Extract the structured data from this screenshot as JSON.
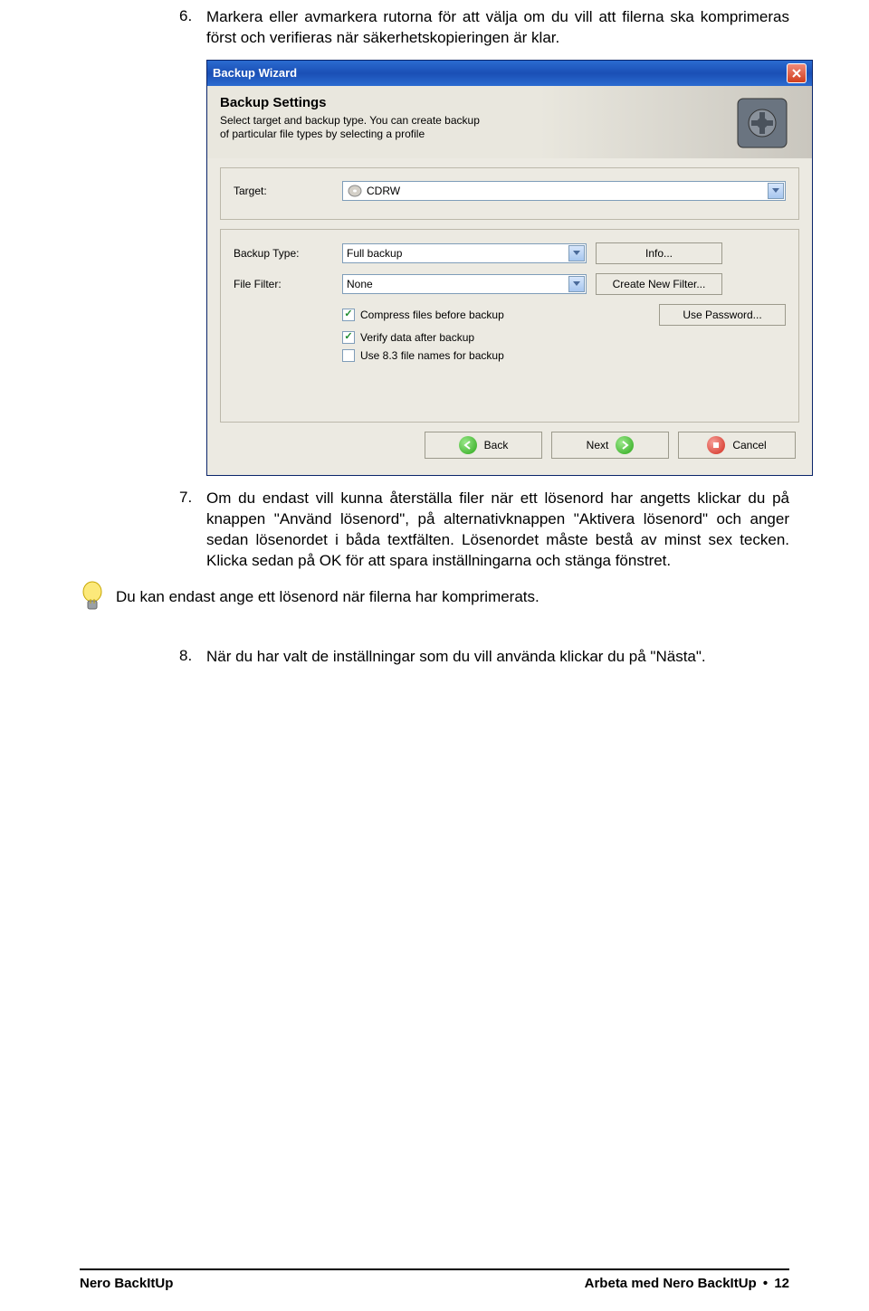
{
  "list": {
    "item6num": "6.",
    "item6text": "Markera eller avmarkera rutorna för att välja om du vill att filerna ska komprimeras först och verifieras när säkerhetskopieringen är klar.",
    "item7num": "7.",
    "item7text": "Om du endast vill kunna återställa filer när ett lösenord har angetts klickar du på knappen \"Använd lösenord\", på alternativknappen \"Aktivera lösenord\" och anger sedan lösenordet i båda textfälten. Lösenordet måste bestå av minst sex tecken. Klicka sedan på OK för att spara inställningarna och stänga fönstret.",
    "item8num": "8.",
    "item8text": "När du har valt de inställningar som du vill använda klickar du på \"Nästa\"."
  },
  "note": "Du kan endast ange ett lösenord när filerna har komprimerats.",
  "dialog": {
    "title": "Backup Wizard",
    "header": "Backup Settings",
    "header_sub": "Select target and backup type. You can create backup of particular file types by selecting a profile",
    "target_label": "Target:",
    "target_value": "CDRW",
    "backup_type_label": "Backup Type:",
    "backup_type_value": "Full backup",
    "info_btn": "Info...",
    "file_filter_label": "File Filter:",
    "file_filter_value": "None",
    "create_filter_btn": "Create New Filter...",
    "use_password_btn": "Use Password...",
    "chk_compress": "Compress files before backup",
    "chk_verify": "Verify data after backup",
    "chk_83": "Use 8.3 file names for backup",
    "back_btn": "Back",
    "next_btn": "Next",
    "cancel_btn": "Cancel"
  },
  "footer": {
    "left": "Nero BackItUp",
    "right_prefix": "Arbeta med Nero BackItUp",
    "right_page": "12"
  }
}
